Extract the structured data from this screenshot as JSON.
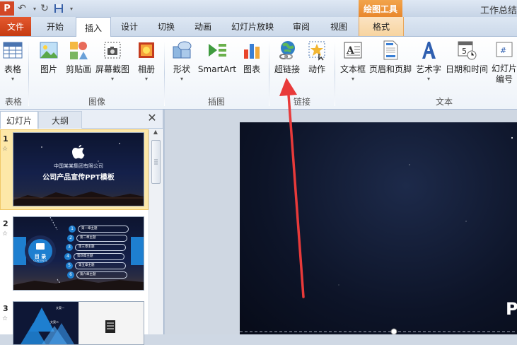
{
  "window": {
    "title": "工作总结",
    "context_tab_group": "绘图工具"
  },
  "tabs": [
    "文件",
    "开始",
    "插入",
    "设计",
    "切换",
    "动画",
    "幻灯片放映",
    "审阅",
    "视图",
    "格式"
  ],
  "ribbon": {
    "buttons": {
      "table": "表格",
      "picture": "图片",
      "clipart": "剪贴画",
      "screenshot": "屏幕截图",
      "album": "相册",
      "shapes": "形状",
      "smartart": "SmartArt",
      "chart": "图表",
      "hyperlink": "超链接",
      "action": "动作",
      "textbox": "文本框",
      "header_footer": "页眉和页脚",
      "wordart": "艺术字",
      "datetime": "日期和时间",
      "slide_number_1": "幻灯片",
      "slide_number_2": "编号"
    },
    "groups": {
      "tables": "表格",
      "images": "图像",
      "illustrations": "插图",
      "links": "链接",
      "text": "文本"
    }
  },
  "panel": {
    "tab_slides": "幻灯片",
    "tab_outline": "大纲",
    "close_glyph": "✕",
    "slides": [
      {
        "number": "1",
        "company": "中国某某集团有限公司",
        "title": "公司产品宣传PPT模板"
      },
      {
        "number": "2",
        "toc_title": "目 录",
        "toc_sub": "CONTENTS",
        "items": [
          {
            "n": "1",
            "text": "第一章主题"
          },
          {
            "n": "2",
            "text": "第二章主题"
          },
          {
            "n": "3",
            "text": "第三章主题"
          },
          {
            "n": "4",
            "text": "第四章主题"
          },
          {
            "n": "5",
            "text": "第五章主题"
          },
          {
            "n": "6",
            "text": "第六章主题"
          }
        ]
      },
      {
        "number": "3",
        "label_a": "文案一",
        "label_b": "文案二"
      }
    ]
  },
  "main_slide": {
    "partial_text": "P"
  },
  "colors": {
    "file_tab": "#d24726",
    "context_orange": "#e8862b",
    "selection": "#fde8a8",
    "toc_blue": "#1e7fd0",
    "annotation_arrow": "#e83a3a"
  }
}
